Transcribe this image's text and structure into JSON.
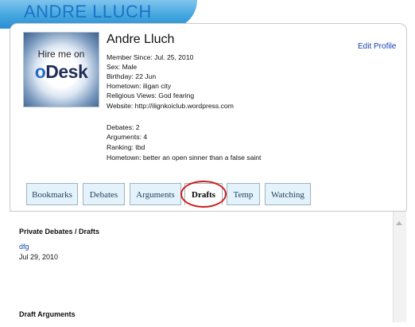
{
  "header": {
    "title": "ANDRE LLUCH"
  },
  "profile": {
    "avatar_text_line1": "Hire me on",
    "avatar_text_line2_o": "o",
    "avatar_text_line2_rest": "Desk",
    "name": "Andre Lluch",
    "edit_link": "Edit Profile",
    "details": [
      "Member Since: Jul. 25, 2010",
      "Sex: Male",
      "Birthday: 22 Jun",
      "Hometown: iligan city",
      "Religious Views: God fearing",
      "Website: http://ilignkoiclub.wordpress.com"
    ],
    "stats": [
      "Debates: 2",
      "Arguments: 4",
      "Ranking: tbd",
      "Hometown: better an open sinner than a false saint"
    ]
  },
  "tabs": [
    {
      "label": "Bookmarks"
    },
    {
      "label": "Debates"
    },
    {
      "label": "Arguments"
    },
    {
      "label": "Drafts"
    },
    {
      "label": "Temp"
    },
    {
      "label": "Watching"
    }
  ],
  "active_tab": "Drafts",
  "content": {
    "private_title": "Private Debates / Drafts",
    "draft_link": "dfg",
    "draft_date": "Jul 29, 2010",
    "arguments_title": "Draft Arguments"
  },
  "colors": {
    "header_blue": "#43a6e0",
    "title_blue": "#1b73c6",
    "link_blue": "#1540b5",
    "tab_bg": "#e4f3fb",
    "highlight_red": "#cf1d1d"
  }
}
